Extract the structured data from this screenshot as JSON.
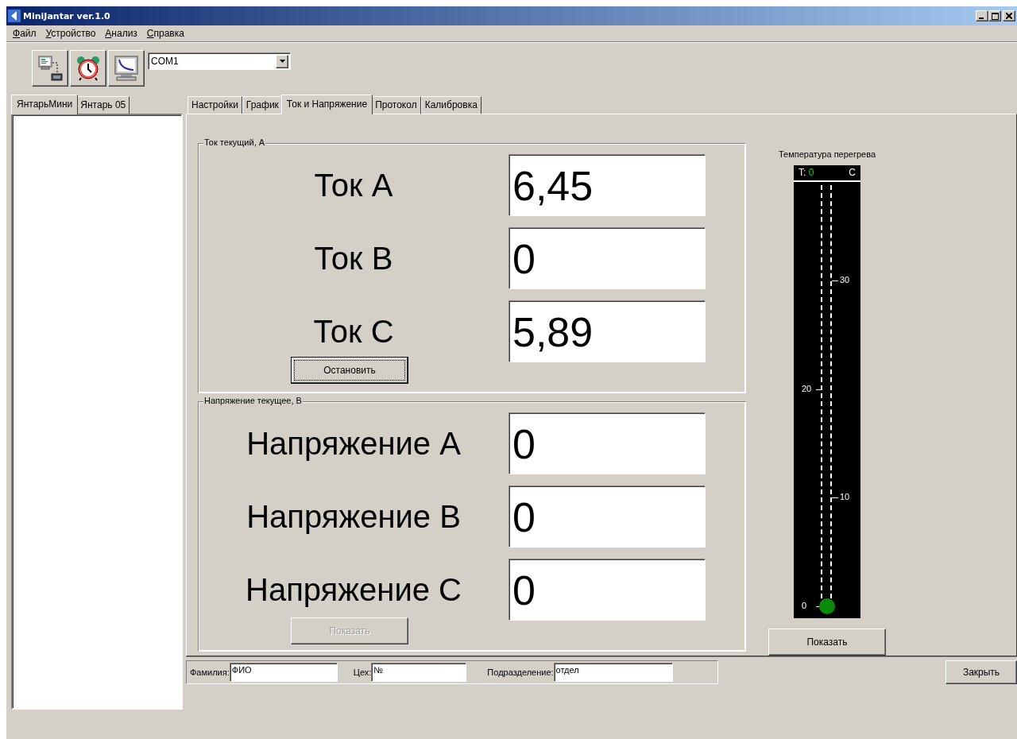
{
  "window": {
    "title": "MiniJantar ver.1.0"
  },
  "menu": [
    {
      "label": "Файл"
    },
    {
      "label": "Устройство"
    },
    {
      "label": "Анализ"
    },
    {
      "label": "Справка"
    }
  ],
  "toolbar": {
    "port": "COM1"
  },
  "device_tabs": [
    {
      "label": "ЯнтарьМини",
      "selected": true
    },
    {
      "label": "Янтарь 05",
      "selected": false
    }
  ],
  "main_tabs": [
    {
      "label": "Настройки",
      "selected": false
    },
    {
      "label": "График",
      "selected": false
    },
    {
      "label": "Ток и Напряжение",
      "selected": true
    },
    {
      "label": "Протокол",
      "selected": false
    },
    {
      "label": "Калибровка",
      "selected": false
    }
  ],
  "groups": [
    {
      "title": "Ток текущий, А",
      "readings": [
        {
          "label": "Ток A",
          "value": "6,45"
        },
        {
          "label": "Ток B",
          "value": "0"
        },
        {
          "label": "Ток C",
          "value": "5,89"
        }
      ],
      "button": {
        "label": "Остановить",
        "disabled": false,
        "focused": true
      }
    },
    {
      "title": "Напряжение текущее, В",
      "readings": [
        {
          "label": "Напряжение A",
          "value": "0"
        },
        {
          "label": "Напряжение B",
          "value": "0"
        },
        {
          "label": "Напряжение C",
          "value": "0"
        }
      ],
      "button": {
        "label": "Показать",
        "disabled": true,
        "focused": false
      }
    }
  ],
  "temperature": {
    "title": "Температура перегрева",
    "reading_label": "T:",
    "reading": "0",
    "unit": "C",
    "ticks": [
      "30",
      "20",
      "10",
      "0"
    ],
    "button": "Показать"
  },
  "footer": {
    "fields": [
      {
        "label": "Фамилия:",
        "value": "ФИО"
      },
      {
        "label": "Цех:",
        "value": "№"
      },
      {
        "label": "Подразделение:",
        "value": "отдел"
      }
    ],
    "close_button": "Закрыть"
  }
}
